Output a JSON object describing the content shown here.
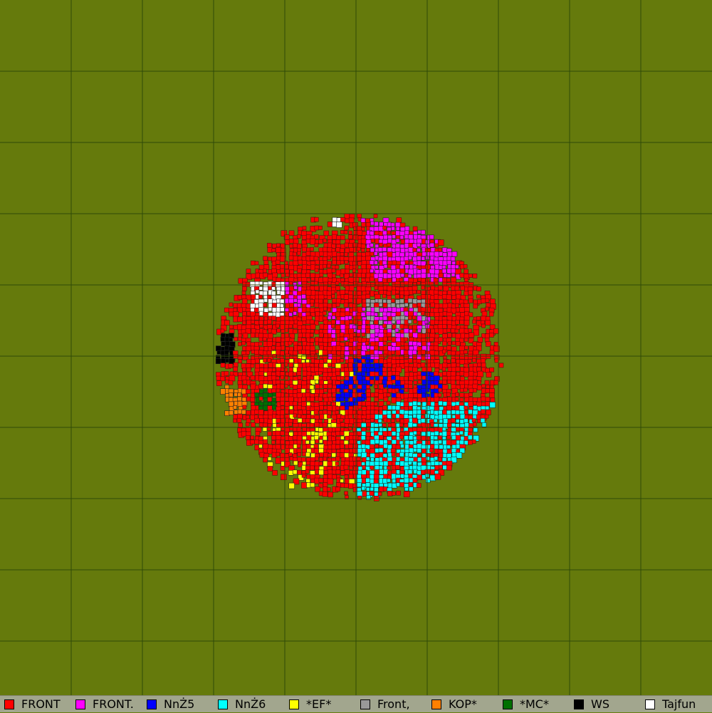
{
  "map": {
    "background_color": "#657a0c",
    "grid_color": "#2f4a08",
    "territory_outline_color": "#5a1010",
    "grid_cells": 10
  },
  "tribes": [
    {
      "name": "FRONT",
      "color": "#ff0000"
    },
    {
      "name": "FRONT.",
      "color": "#ff00ff"
    },
    {
      "name": "NnŻ5",
      "color": "#0000ff"
    },
    {
      "name": "NnŻ6",
      "color": "#00ffff"
    },
    {
      "name": "*EF*",
      "color": "#ffff00"
    },
    {
      "name": "Front,",
      "color": "#999999"
    },
    {
      "name": "KOP*",
      "color": "#ff8000"
    },
    {
      "name": "*MC*",
      "color": "#007000"
    },
    {
      "name": "WS",
      "color": "#000000"
    },
    {
      "name": "Tajfun",
      "color": "#ffffff"
    }
  ]
}
